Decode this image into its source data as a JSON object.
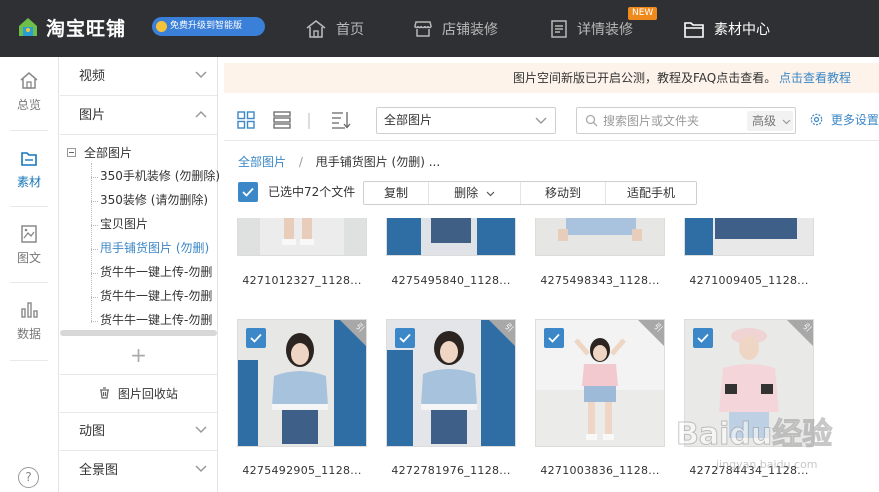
{
  "header": {
    "app_title": "淘宝旺铺",
    "upgrade_label": "免费升级到智能版",
    "nav": [
      {
        "label": "首页",
        "icon": "home-icon"
      },
      {
        "label": "店铺装修",
        "icon": "shop-icon"
      },
      {
        "label": "详情装修",
        "icon": "detail-icon"
      },
      {
        "label": "素材中心",
        "icon": "folder-icon"
      }
    ],
    "new_badge": "NEW"
  },
  "rail": {
    "items": [
      {
        "label": "总览",
        "icon": "home-icon"
      },
      {
        "label": "素材",
        "icon": "material-icon"
      },
      {
        "label": "图文",
        "icon": "image-text-icon"
      },
      {
        "label": "数据",
        "icon": "chart-icon"
      }
    ],
    "active": "素材",
    "help": "?"
  },
  "sidebar": {
    "video": "视频",
    "images": "图片",
    "tree_root": "全部图片",
    "tree_items": [
      "350手机装修 (勿删除)",
      "350装修 (请勿删除)",
      "宝贝图片",
      "甩手铺货图片 (勿删)",
      "货牛牛一键上传-勿删",
      "货牛牛一键上传-勿删",
      "货牛牛一键上传-勿删"
    ],
    "selected_item": "甩手铺货图片 (勿删)",
    "add": "+",
    "recycle": "图片回收站",
    "animated": "动图",
    "panorama": "全景图"
  },
  "notice": {
    "text": "图片空间新版已开启公测，教程及FAQ点击查看。",
    "link": "点击查看教程"
  },
  "toolbar": {
    "dropdown_value": "全部图片",
    "search_placeholder": "搜索图片或文件夹",
    "advanced": "高级",
    "more_settings": "更多设置"
  },
  "breadcrumb": {
    "root": "全部图片",
    "current": "甩手铺货图片 (勿删) ..."
  },
  "selection": {
    "text": "已选中72个文件",
    "actions": [
      "复制",
      "删除",
      "移动到",
      "适配手机"
    ]
  },
  "files_row1": [
    "4271012327_1128...",
    "4275495840_1128...",
    "4275498343_1128...",
    "4271009405_1128..."
  ],
  "files_row2": [
    "4275492905_1128...",
    "4272781976_1128...",
    "4271003836_1128...",
    "4272784434_1128..."
  ],
  "corner_badge": "引",
  "colors": {
    "accent": "#3b87c7",
    "topbar": "#2f3033",
    "notice_bg": "#fdf3ea",
    "badge": "#f08a1c"
  },
  "watermark": "Baidu经验"
}
